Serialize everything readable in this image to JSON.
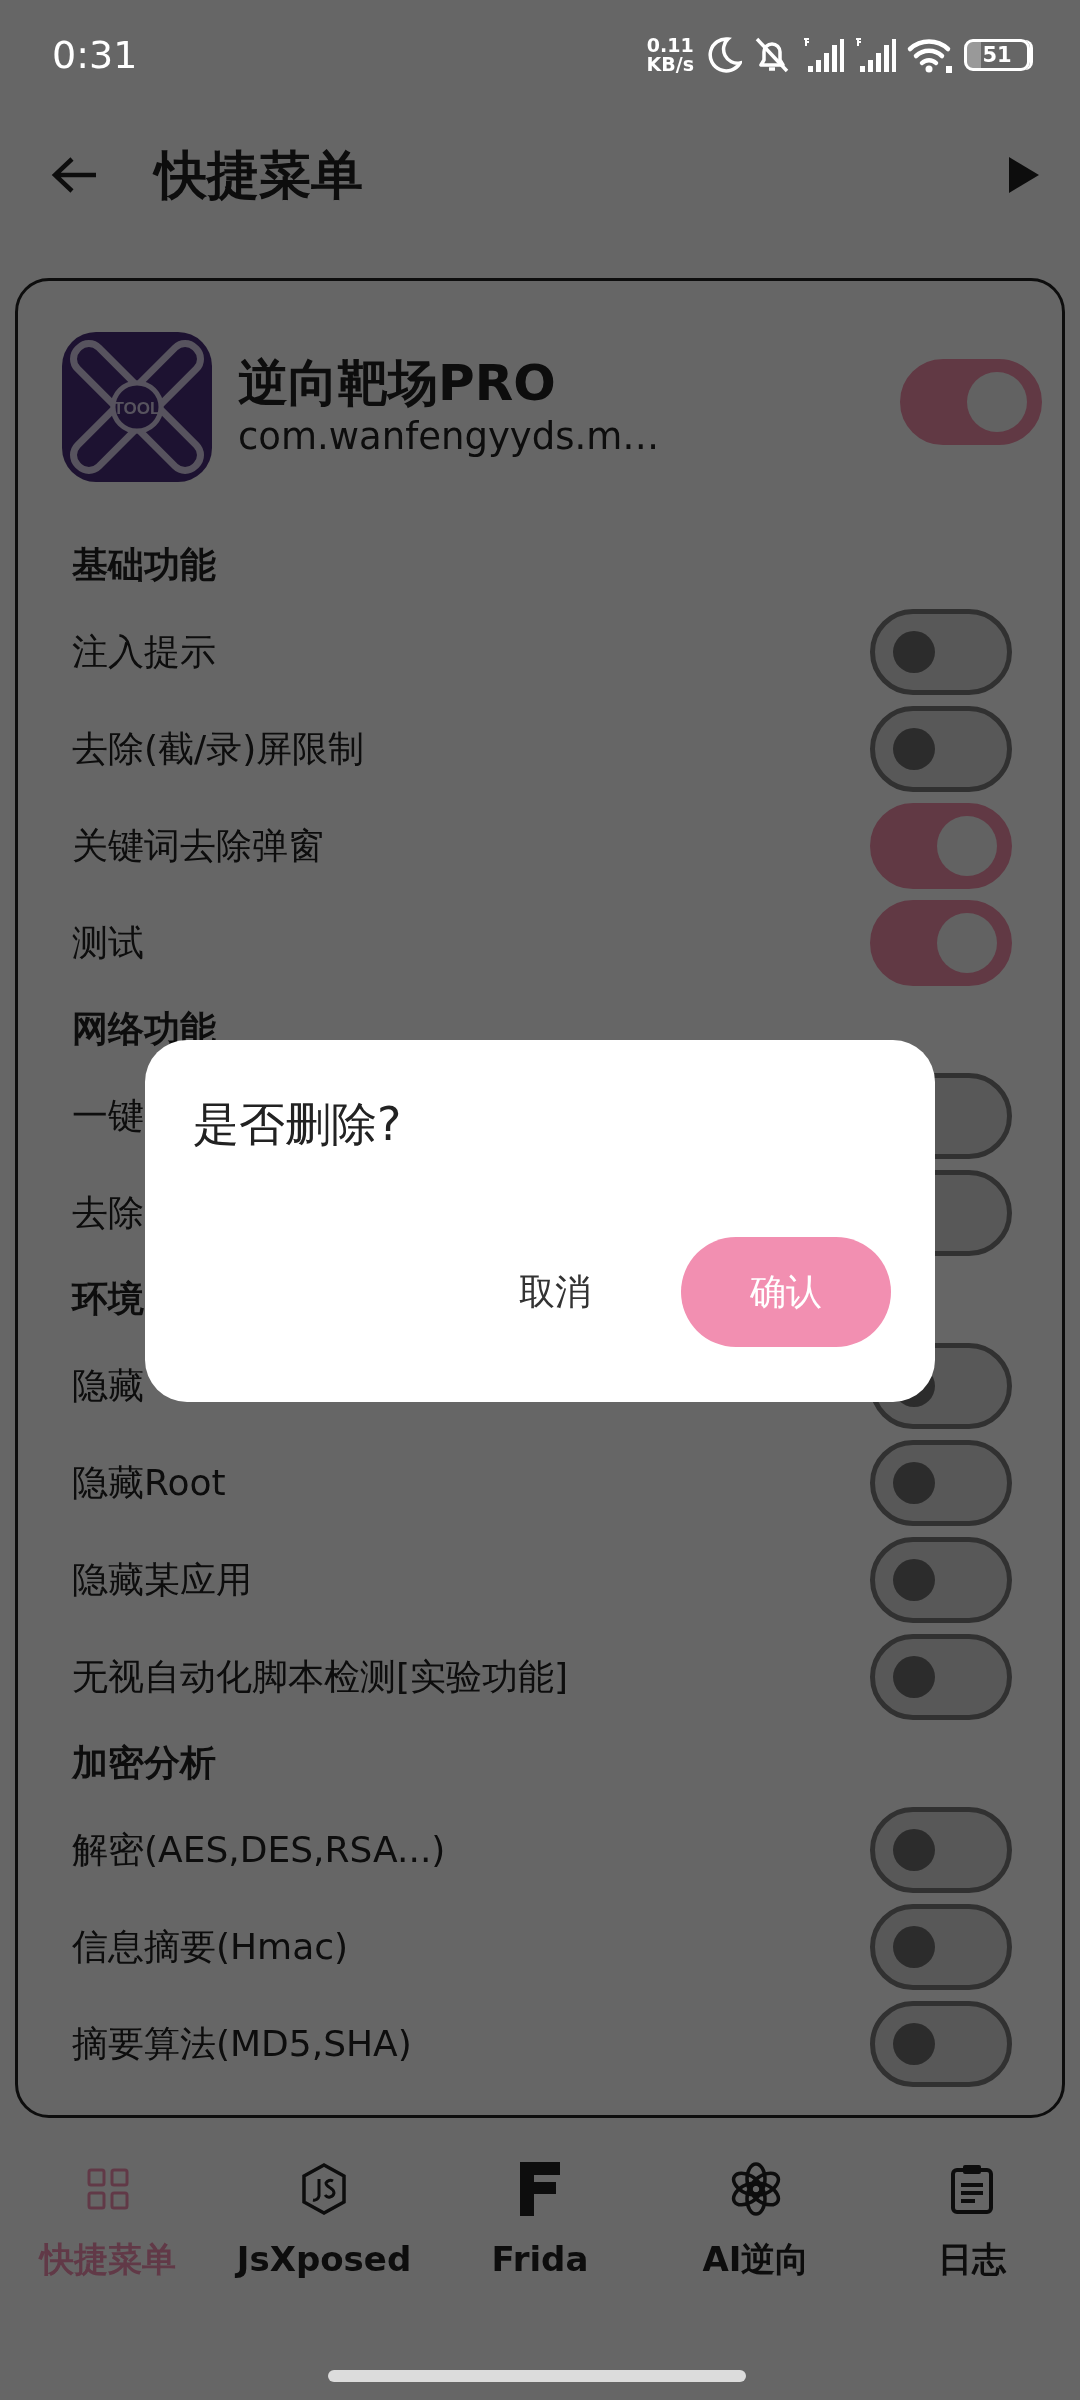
{
  "status_bar": {
    "time": "0:31",
    "net_speed": [
      "0.11",
      "KB/s"
    ],
    "battery": "51"
  },
  "header": {
    "title": "快捷菜单"
  },
  "app": {
    "name": "逆向靶场PRO",
    "package": "com.wanfengyyds.m…",
    "icon_label": "TOOL",
    "on": true
  },
  "sections": [
    {
      "title": "基础功能",
      "items": [
        {
          "label": "注入提示",
          "on": false
        },
        {
          "label": "去除(截/录)屏限制",
          "on": false
        },
        {
          "label": "关键词去除弹窗",
          "on": true
        },
        {
          "label": "测试",
          "on": true
        }
      ]
    },
    {
      "title": "网络功能",
      "items": [
        {
          "label": "一键",
          "on": false
        },
        {
          "label": "去除",
          "on": false
        }
      ]
    },
    {
      "title": "环境",
      "items": [
        {
          "label": "隐藏",
          "on": false
        },
        {
          "label": "隐藏Root",
          "on": false
        },
        {
          "label": "隐藏某应用",
          "on": false
        },
        {
          "label": "无视自动化脚本检测[实验功能]",
          "on": false
        }
      ]
    },
    {
      "title": "加密分析",
      "items": [
        {
          "label": "解密(AES,DES,RSA...)",
          "on": false
        },
        {
          "label": "信息摘要(Hmac)",
          "on": false
        },
        {
          "label": "摘要算法(MD5,SHA)",
          "on": false
        }
      ]
    }
  ],
  "dialog": {
    "title": "是否删除?",
    "buttons": [
      {
        "label": "取消",
        "kind": "text"
      },
      {
        "label": "确认",
        "kind": "primary"
      }
    ]
  },
  "bottom_nav": [
    {
      "label": "快捷菜单",
      "kind": "grid",
      "selected": true
    },
    {
      "label": "JsXposed",
      "kind": "js",
      "selected": false
    },
    {
      "label": "Frida",
      "kind": "frida",
      "selected": false
    },
    {
      "label": "AI逆向",
      "kind": "ai",
      "selected": false
    },
    {
      "label": "日志",
      "kind": "log",
      "selected": false
    }
  ]
}
